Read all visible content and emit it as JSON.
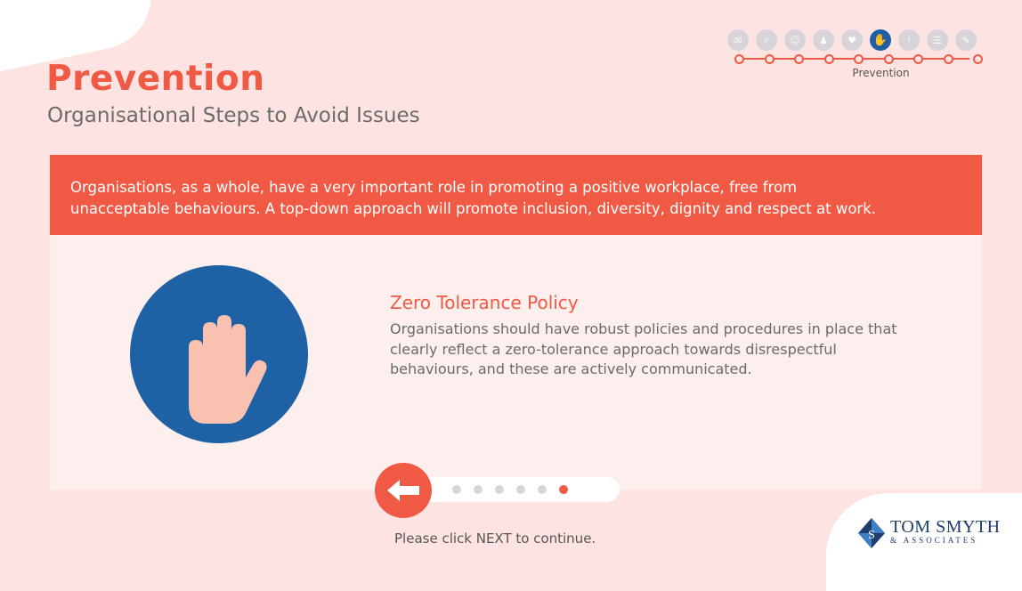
{
  "header": {
    "title": "Prevention",
    "subtitle": "Organisational Steps to Avoid Issues"
  },
  "tracker": {
    "label": "Prevention",
    "steps": [
      {
        "icon": "chat-icon",
        "glyph": "✉"
      },
      {
        "icon": "search-icon",
        "glyph": "⌕"
      },
      {
        "icon": "people-icon",
        "glyph": "☺"
      },
      {
        "icon": "person-icon",
        "glyph": "♟"
      },
      {
        "icon": "hand-heart-icon",
        "glyph": "♥"
      },
      {
        "icon": "stop-hand-icon",
        "glyph": "✋"
      },
      {
        "icon": "alert-icon",
        "glyph": "!"
      },
      {
        "icon": "list-icon",
        "glyph": "☰"
      },
      {
        "icon": "document-icon",
        "glyph": "✎"
      }
    ],
    "active_index": 5
  },
  "banner": {
    "line1": "Organisations, as a whole, have a very important role in promoting a positive workplace, free from",
    "line2": "unacceptable behaviours. A top-down approach will promote inclusion, diversity, dignity and respect at work."
  },
  "card": {
    "icon": "stop-hand-icon",
    "heading": "Zero Tolerance Policy",
    "body": "Organisations should have robust policies and procedures in place that clearly reflect a zero-tolerance approach towards disrespectful behaviours, and these are actively communicated."
  },
  "pager": {
    "total": 6,
    "active_index": 5
  },
  "footer": {
    "instruction": "Please click NEXT to continue."
  },
  "logo": {
    "line1": "TOM SMYTH",
    "line2": "& ASSOCIATES"
  },
  "colors": {
    "accent": "#f05a45",
    "blue": "#1e62a5",
    "background": "#fde4e3",
    "card": "#fdefed"
  }
}
